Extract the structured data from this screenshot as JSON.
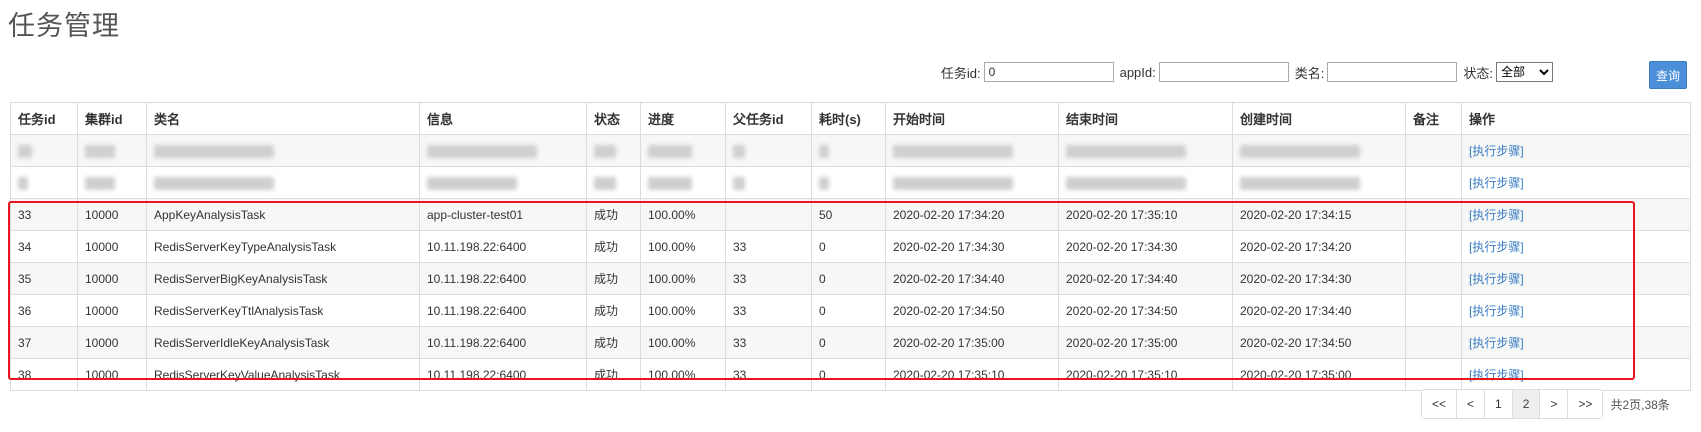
{
  "page_title": "任务管理",
  "filters": {
    "task_id_label": "任务id:",
    "task_id_value": "0",
    "app_id_label": "appId:",
    "app_id_value": "",
    "class_name_label": "类名:",
    "class_name_value": "",
    "status_label": "状态:",
    "status_selected": "全部",
    "query_button": "查询"
  },
  "table": {
    "columns": [
      "任务id",
      "集群id",
      "类名",
      "信息",
      "状态",
      "进度",
      "父任务id",
      "耗时(s)",
      "开始时间",
      "结束时间",
      "创建时间",
      "备注",
      "操作"
    ],
    "redacted_rows": [
      {
        "action": "[执行步骤]"
      },
      {
        "action": "[执行步骤]"
      }
    ],
    "rows": [
      {
        "task_id": "33",
        "cluster_id": "10000",
        "class_name": "AppKeyAnalysisTask",
        "info": "app-cluster-test01",
        "status": "成功",
        "progress": "100.00%",
        "parent_id": "",
        "duration": "50",
        "start_time": "2020-02-20 17:34:20",
        "end_time": "2020-02-20 17:35:10",
        "create_time": "2020-02-20 17:34:15",
        "remark": "",
        "action": "[执行步骤]"
      },
      {
        "task_id": "34",
        "cluster_id": "10000",
        "class_name": "RedisServerKeyTypeAnalysisTask",
        "info": "10.11.198.22:6400",
        "status": "成功",
        "progress": "100.00%",
        "parent_id": "33",
        "duration": "0",
        "start_time": "2020-02-20 17:34:30",
        "end_time": "2020-02-20 17:34:30",
        "create_time": "2020-02-20 17:34:20",
        "remark": "",
        "action": "[执行步骤]"
      },
      {
        "task_id": "35",
        "cluster_id": "10000",
        "class_name": "RedisServerBigKeyAnalysisTask",
        "info": "10.11.198.22:6400",
        "status": "成功",
        "progress": "100.00%",
        "parent_id": "33",
        "duration": "0",
        "start_time": "2020-02-20 17:34:40",
        "end_time": "2020-02-20 17:34:40",
        "create_time": "2020-02-20 17:34:30",
        "remark": "",
        "action": "[执行步骤]"
      },
      {
        "task_id": "36",
        "cluster_id": "10000",
        "class_name": "RedisServerKeyTtlAnalysisTask",
        "info": "10.11.198.22:6400",
        "status": "成功",
        "progress": "100.00%",
        "parent_id": "33",
        "duration": "0",
        "start_time": "2020-02-20 17:34:50",
        "end_time": "2020-02-20 17:34:50",
        "create_time": "2020-02-20 17:34:40",
        "remark": "",
        "action": "[执行步骤]"
      },
      {
        "task_id": "37",
        "cluster_id": "10000",
        "class_name": "RedisServerIdleKeyAnalysisTask",
        "info": "10.11.198.22:6400",
        "status": "成功",
        "progress": "100.00%",
        "parent_id": "33",
        "duration": "0",
        "start_time": "2020-02-20 17:35:00",
        "end_time": "2020-02-20 17:35:00",
        "create_time": "2020-02-20 17:34:50",
        "remark": "",
        "action": "[执行步骤]"
      },
      {
        "task_id": "38",
        "cluster_id": "10000",
        "class_name": "RedisServerKeyValueAnalysisTask",
        "info": "10.11.198.22:6400",
        "status": "成功",
        "progress": "100.00%",
        "parent_id": "33",
        "duration": "0",
        "start_time": "2020-02-20 17:35:10",
        "end_time": "2020-02-20 17:35:10",
        "create_time": "2020-02-20 17:35:00",
        "remark": "",
        "action": "[执行步骤]"
      }
    ]
  },
  "pagination": {
    "first": "<<",
    "prev": "<",
    "pages": [
      "1",
      "2"
    ],
    "current": "2",
    "next": ">",
    "last": ">>",
    "summary": "共2页,38条"
  },
  "colors": {
    "query_button": "#4a8fd8",
    "link": "#3a7cc0",
    "highlight_box": "#e8161e"
  }
}
